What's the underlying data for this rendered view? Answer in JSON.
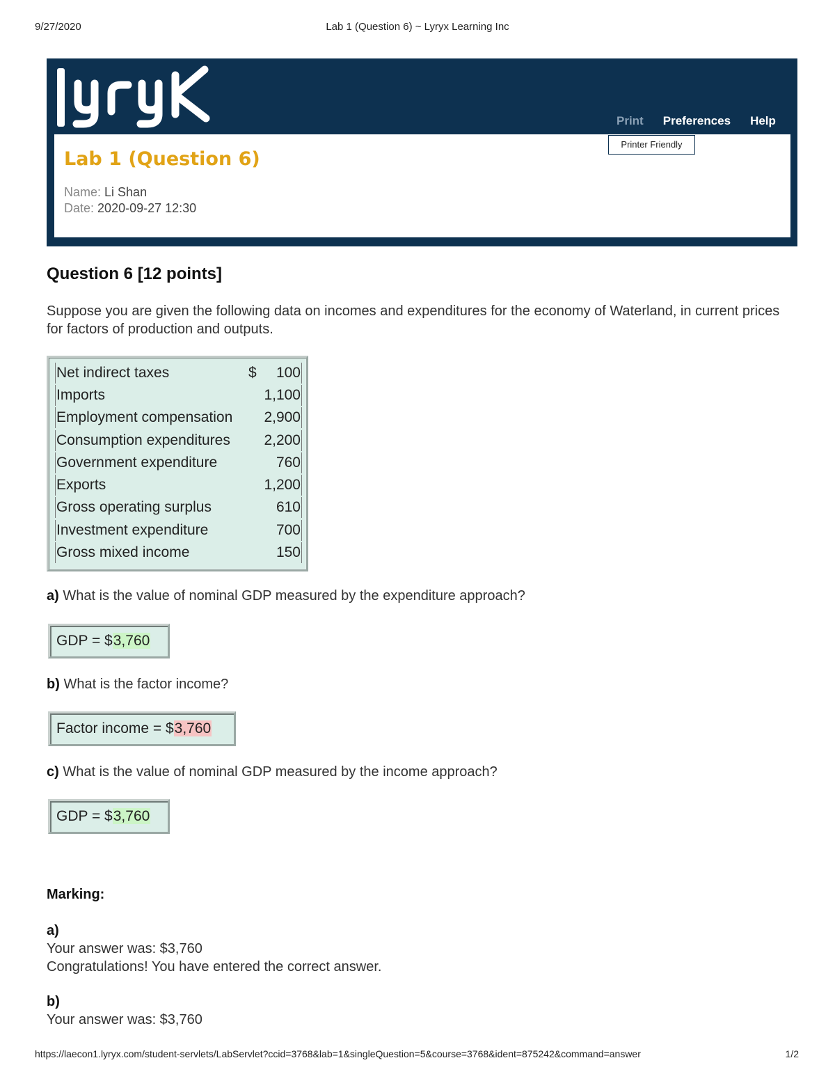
{
  "print_header": {
    "date": "9/27/2020",
    "title": "Lab 1 (Question 6) ~ Lyryx Learning Inc"
  },
  "app": {
    "logo_text": "lyryx",
    "nav": {
      "print": "Print",
      "preferences": "Preferences",
      "help": "Help"
    },
    "print_menu": {
      "printer_friendly": "Printer Friendly"
    },
    "lab_title": "Lab 1 (Question 6)",
    "name_label": "Name:",
    "name_value": "Li Shan",
    "date_label": "Date:",
    "date_value": "2020-09-27 12:30",
    "colors": {
      "banner": "#0d3150",
      "title_accent": "#e1a316",
      "correct": "#ccf5c6",
      "incorrect": "#f7c3c3"
    }
  },
  "question": {
    "heading": "Question 6 [12 points]",
    "intro": "Suppose you are given the following data on incomes and expenditures for the economy of Waterland, in current prices for factors of production and outputs.",
    "table": {
      "currency": "$",
      "rows": [
        {
          "label": "Net indirect taxes",
          "value": "100"
        },
        {
          "label": "Imports",
          "value": "1,100"
        },
        {
          "label": "Employment compensation",
          "value": "2,900"
        },
        {
          "label": "Consumption expenditures",
          "value": "2,200"
        },
        {
          "label": "Government expenditure",
          "value": "760"
        },
        {
          "label": "Exports",
          "value": "1,200"
        },
        {
          "label": "Gross operating surplus",
          "value": "610"
        },
        {
          "label": "Investment expenditure",
          "value": "700"
        },
        {
          "label": "Gross mixed income",
          "value": "150"
        }
      ]
    },
    "parts": [
      {
        "letter": "a)",
        "text": "What is the value of nominal GDP measured by the expenditure approach?",
        "answer_prefix": "GDP = $",
        "answer_value": "3,760",
        "status": "correct"
      },
      {
        "letter": "b)",
        "text": "What is the factor income?",
        "answer_prefix": "Factor income = $",
        "answer_value": "3,760",
        "status": "incorrect"
      },
      {
        "letter": "c)",
        "text": "What is the value of nominal GDP measured by the income approach?",
        "answer_prefix": "GDP = $",
        "answer_value": "3,760",
        "status": "correct"
      }
    ]
  },
  "marking": {
    "heading": "Marking:",
    "items": [
      {
        "letter": "a)",
        "answer_line": "Your answer was:  $3,760",
        "feedback": "Congratulations! You have entered the correct answer."
      },
      {
        "letter": "b)",
        "answer_line": "Your answer was:  $3,760"
      }
    ]
  },
  "print_footer": {
    "url": "https://laecon1.lyryx.com/student-servlets/LabServlet?ccid=3768&lab=1&singleQuestion=5&course=3768&ident=875242&command=answer",
    "page": "1/2"
  }
}
